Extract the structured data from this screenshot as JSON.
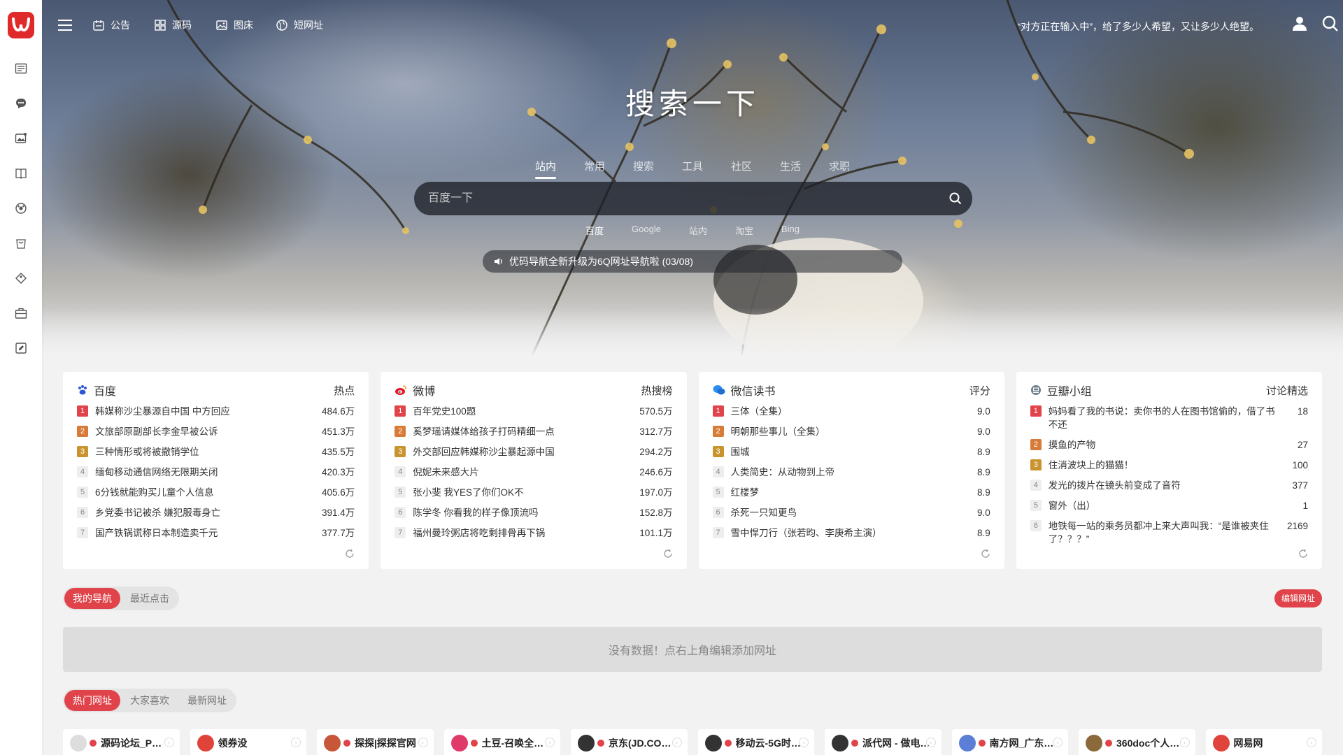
{
  "topbar": {
    "nav": [
      {
        "label": "公告",
        "icon": "announcement-icon"
      },
      {
        "label": "源码",
        "icon": "grid-icon"
      },
      {
        "label": "图床",
        "icon": "image-icon"
      },
      {
        "label": "短网址",
        "icon": "globe-icon"
      }
    ],
    "quote": "“对方正在输入中”，给了多少人希望，又让多少人绝望。"
  },
  "hero": {
    "title": "搜索一下",
    "tabs": [
      "站内",
      "常用",
      "搜索",
      "工具",
      "社区",
      "生活",
      "求职"
    ],
    "active_tab": "站内",
    "search_placeholder": "百度一下",
    "engines": [
      "百度",
      "Google",
      "站内",
      "淘宝",
      "Bing"
    ],
    "active_engine": "百度",
    "notice": "优码导航全新升级为6Q网址导航啦 (03/08)"
  },
  "hot_cards": [
    {
      "title": "百度",
      "right": "热点",
      "icon": "baidu-paw-icon",
      "items": [
        {
          "text": "韩媒称沙尘暴源自中国 中方回应",
          "value": "484.6万"
        },
        {
          "text": "文旅部原副部长李金早被公诉",
          "value": "451.3万"
        },
        {
          "text": "三种情形或将被撤销学位",
          "value": "435.5万"
        },
        {
          "text": "缅甸移动通信网络无限期关闭",
          "value": "420.3万"
        },
        {
          "text": "6分钱就能购买儿童个人信息",
          "value": "405.6万"
        },
        {
          "text": "乡党委书记被杀 嫌犯服毒身亡",
          "value": "391.4万"
        },
        {
          "text": "国产铁锅谎称日本制造卖千元",
          "value": "377.7万"
        }
      ]
    },
    {
      "title": "微博",
      "right": "热搜榜",
      "icon": "weibo-icon",
      "items": [
        {
          "text": "百年党史100题",
          "value": "570.5万"
        },
        {
          "text": "奚梦瑶请媒体给孩子打码精细一点",
          "value": "312.7万"
        },
        {
          "text": "外交部回应韩媒称沙尘暴起源中国",
          "value": "294.2万"
        },
        {
          "text": "倪妮未来感大片",
          "value": "246.6万"
        },
        {
          "text": "张小斐 我YES了你们OK不",
          "value": "197.0万"
        },
        {
          "text": "陈学冬 你看我的样子像顶流吗",
          "value": "152.8万"
        },
        {
          "text": "福州曼玲粥店将吃剩排骨再下锅",
          "value": "101.1万"
        }
      ]
    },
    {
      "title": "微信读书",
      "right": "评分",
      "icon": "wechat-read-icon",
      "items": [
        {
          "text": "三体（全集）",
          "value": "9.0"
        },
        {
          "text": "明朝那些事儿（全集）",
          "value": "9.0"
        },
        {
          "text": "围城",
          "value": "8.9"
        },
        {
          "text": "人类简史：从动物到上帝",
          "value": "8.9"
        },
        {
          "text": "红楼梦",
          "value": "8.9"
        },
        {
          "text": "杀死一只知更鸟",
          "value": "9.0"
        },
        {
          "text": "雪中悍刀行（张若昀、李庚希主演）",
          "value": "8.9"
        }
      ]
    },
    {
      "title": "豆瓣小组",
      "right": "讨论精选",
      "icon": "douban-icon",
      "items": [
        {
          "text": "妈妈看了我的书说：卖你书的人在图书馆偷的，借了书不还",
          "value": "18"
        },
        {
          "text": "摸鱼的产物",
          "value": "27"
        },
        {
          "text": "住消波块上的猫猫！",
          "value": "100"
        },
        {
          "text": "发光的拨片在镜头前变成了音符",
          "value": "377"
        },
        {
          "text": "窗外（出）",
          "value": "1"
        },
        {
          "text": "地铁每一站的乘务员都冲上来大声叫我：“是谁被夹住了？？？”",
          "value": "2169"
        }
      ]
    }
  ],
  "my_nav": {
    "tabs": [
      "我的导航",
      "最近点击"
    ],
    "edit_label": "编辑网址",
    "empty_text": "没有数据！点右上角编辑添加网址"
  },
  "hot_sites": {
    "tabs": [
      "热门网址",
      "大家喜欢",
      "最新网址"
    ],
    "items": [
      {
        "name": "源码论坛_P…",
        "color": "#dddddd",
        "badge": true
      },
      {
        "name": "领券没",
        "color": "#e0433a",
        "badge": false
      },
      {
        "name": "探探|探探官网",
        "color": "#c8573a",
        "badge": true
      },
      {
        "name": "土豆-召唤全…",
        "color": "#e03a6a",
        "badge": true
      },
      {
        "name": "京东(JD.CO…",
        "color": "#333333",
        "badge": true
      },
      {
        "name": "移动云-5G时…",
        "color": "#333333",
        "badge": true
      },
      {
        "name": "派代网 - 做电…",
        "color": "#333333",
        "badge": true
      },
      {
        "name": "南方网_广东…",
        "color": "#5b7fd6",
        "badge": true
      },
      {
        "name": "360doc个人…",
        "color": "#8a6a3a",
        "badge": true
      },
      {
        "name": "网易网",
        "color": "#e0433a",
        "badge": false
      }
    ]
  },
  "colors": {
    "accent": "#e0434a",
    "logo": "#e02a2a",
    "rank2": "#d97b38",
    "rank3": "#c9932e"
  }
}
